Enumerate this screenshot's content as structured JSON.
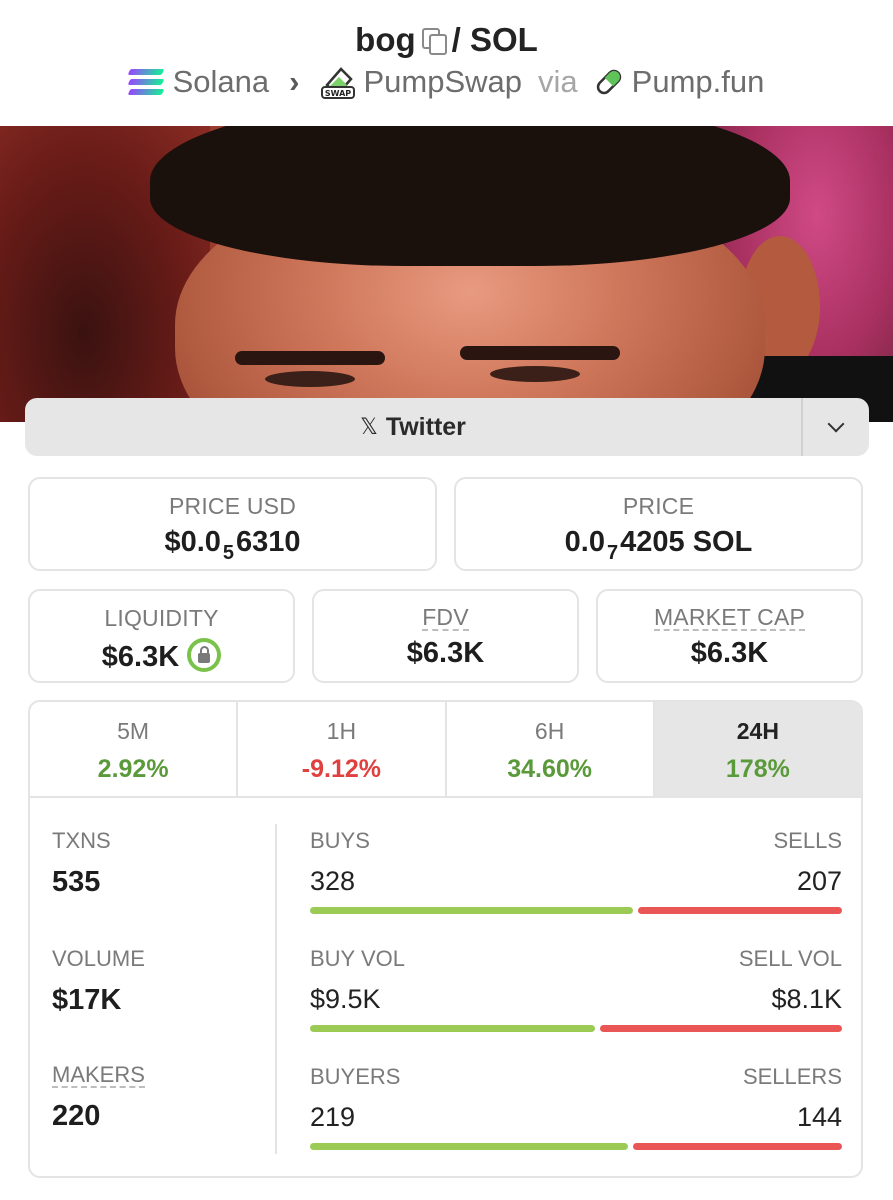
{
  "header": {
    "token": "bog",
    "quote": "/ SOL",
    "chain": "Solana",
    "dex": "PumpSwap",
    "via": "via",
    "launchpad": "Pump.fun",
    "swap_badge": "SWAP"
  },
  "social": {
    "twitter_label": "Twitter",
    "x_glyph": "𝕏"
  },
  "price_usd": {
    "label": "PRICE USD",
    "prefix": "$0.0",
    "zeros": "5",
    "digits": "6310"
  },
  "price_native": {
    "label": "PRICE",
    "prefix": "0.0",
    "zeros": "7",
    "digits": "4205 SOL"
  },
  "liquidity": {
    "label": "LIQUIDITY",
    "value": "$6.3K",
    "locked": true
  },
  "fdv": {
    "label": "FDV",
    "value": "$6.3K"
  },
  "market_cap": {
    "label": "MARKET CAP",
    "value": "$6.3K"
  },
  "timeframes": [
    {
      "label": "5M",
      "change": "2.92%",
      "direction": "up"
    },
    {
      "label": "1H",
      "change": "-9.12%",
      "direction": "down"
    },
    {
      "label": "6H",
      "change": "34.60%",
      "direction": "up"
    },
    {
      "label": "24H",
      "change": "178%",
      "direction": "up",
      "selected": true
    }
  ],
  "stats": {
    "txns": {
      "label": "TXNS",
      "value": "535"
    },
    "volume": {
      "label": "VOLUME",
      "value": "$17K"
    },
    "makers": {
      "label": "MAKERS",
      "value": "220"
    },
    "buys": {
      "label": "BUYS",
      "value": "328",
      "sell_label": "SELLS",
      "sell_value": "207",
      "buy_fraction": 0.613
    },
    "buy_vol": {
      "label": "BUY VOL",
      "value": "$9.5K",
      "sell_label": "SELL VOL",
      "sell_value": "$8.1K",
      "buy_fraction": 0.54
    },
    "buyers": {
      "label": "BUYERS",
      "value": "219",
      "sell_label": "SELLERS",
      "sell_value": "144",
      "buy_fraction": 0.603
    }
  },
  "colors": {
    "positive": "#5a9a3a",
    "negative": "#e0403e",
    "buy_bar": "#9bcb55",
    "sell_bar": "#ea5555"
  }
}
